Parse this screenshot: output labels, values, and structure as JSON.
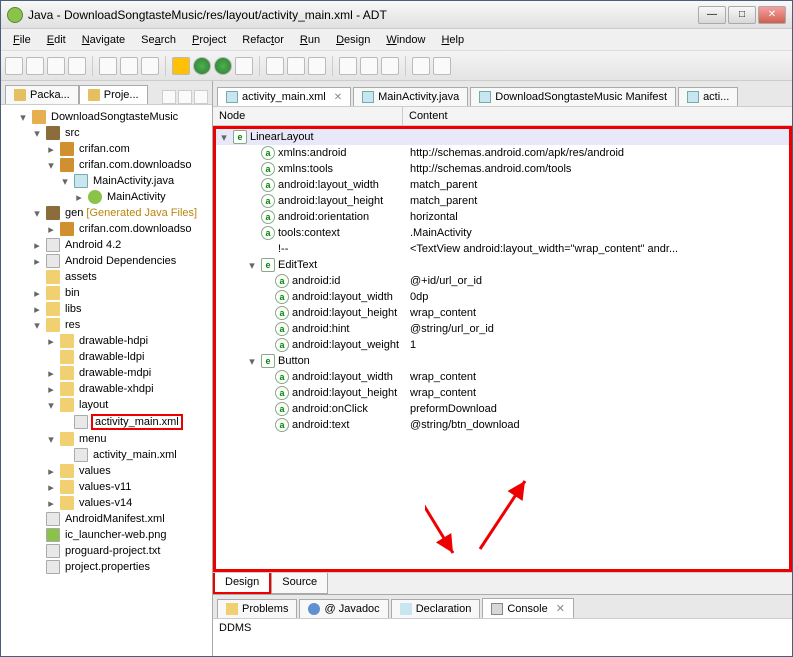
{
  "titlebar": {
    "title": "Java - DownloadSongtasteMusic/res/layout/activity_main.xml - ADT"
  },
  "menu": [
    "File",
    "Edit",
    "Navigate",
    "Search",
    "Project",
    "Refactor",
    "Run",
    "Design",
    "Window",
    "Help"
  ],
  "left_tabs": {
    "packa": "Packa...",
    "proje": "Proje..."
  },
  "project_tree": {
    "root": "DownloadSongtasteMusic",
    "src": "src",
    "pkg1": "crifan.com",
    "pkg2": "crifan.com.downloadsongtastemusic",
    "mainjava": "MainActivity.java",
    "maincls": "MainActivity",
    "gen": "gen",
    "gen_label": "[Generated Java Files]",
    "genpkg": "crifan.com.downloadsongtastemusic",
    "android": "Android 4.2",
    "deps": "Android Dependencies",
    "assets": "assets",
    "bin": "bin",
    "libs": "libs",
    "res": "res",
    "dh": "drawable-hdpi",
    "dl": "drawable-ldpi",
    "dm": "drawable-mdpi",
    "dx": "drawable-xhdpi",
    "layout": "layout",
    "actmain": "activity_main.xml",
    "menu": "menu",
    "menumain": "activity_main.xml",
    "values": "values",
    "values11": "values-v11",
    "values14": "values-v14",
    "manifest": "AndroidManifest.xml",
    "launcher": "ic_launcher-web.png",
    "proguard": "proguard-project.txt",
    "projprop": "project.properties"
  },
  "editor_tabs": [
    {
      "label": "activity_main.xml",
      "active": true
    },
    {
      "label": "MainActivity.java",
      "active": false
    },
    {
      "label": "DownloadSongtasteMusic Manifest",
      "active": false
    },
    {
      "label": "acti...",
      "active": false
    }
  ],
  "xml_headers": {
    "node": "Node",
    "content": "Content"
  },
  "xml_rows": [
    {
      "d": 0,
      "t": "e",
      "arr": "▾",
      "name": "LinearLayout",
      "content": ""
    },
    {
      "d": 1,
      "t": "a",
      "name": "xmlns:android",
      "content": "http://schemas.android.com/apk/res/android"
    },
    {
      "d": 1,
      "t": "a",
      "name": "xmlns:tools",
      "content": "http://schemas.android.com/tools"
    },
    {
      "d": 1,
      "t": "a",
      "name": "android:layout_width",
      "content": "match_parent"
    },
    {
      "d": 1,
      "t": "a",
      "name": "android:layout_height",
      "content": "match_parent"
    },
    {
      "d": 1,
      "t": "a",
      "name": "android:orientation",
      "content": "horizontal"
    },
    {
      "d": 1,
      "t": "a",
      "name": "tools:context",
      "content": ".MainActivity"
    },
    {
      "d": 1,
      "t": "c",
      "name": "!--",
      "content": "<TextView        android:layout_width=\"wrap_content\"        andr..."
    },
    {
      "d": 1,
      "t": "e",
      "arr": "▾",
      "name": "EditText",
      "content": ""
    },
    {
      "d": 2,
      "t": "a",
      "name": "android:id",
      "content": "@+id/url_or_id"
    },
    {
      "d": 2,
      "t": "a",
      "name": "android:layout_width",
      "content": "0dp"
    },
    {
      "d": 2,
      "t": "a",
      "name": "android:layout_height",
      "content": "wrap_content"
    },
    {
      "d": 2,
      "t": "a",
      "name": "android:hint",
      "content": "@string/url_or_id"
    },
    {
      "d": 2,
      "t": "a",
      "name": "android:layout_weight",
      "content": "1"
    },
    {
      "d": 1,
      "t": "e",
      "arr": "▾",
      "name": "Button",
      "content": ""
    },
    {
      "d": 2,
      "t": "a",
      "name": "android:layout_width",
      "content": "wrap_content"
    },
    {
      "d": 2,
      "t": "a",
      "name": "android:layout_height",
      "content": "wrap_content"
    },
    {
      "d": 2,
      "t": "a",
      "name": "android:onClick",
      "content": "preformDownload"
    },
    {
      "d": 2,
      "t": "a",
      "name": "android:text",
      "content": "@string/btn_download"
    }
  ],
  "design_tabs": {
    "design": "Design",
    "source": "Source"
  },
  "bottom_tabs": {
    "problems": "Problems",
    "javadoc": "Javadoc",
    "declaration": "Declaration",
    "console": "Console"
  },
  "console_text": "DDMS"
}
